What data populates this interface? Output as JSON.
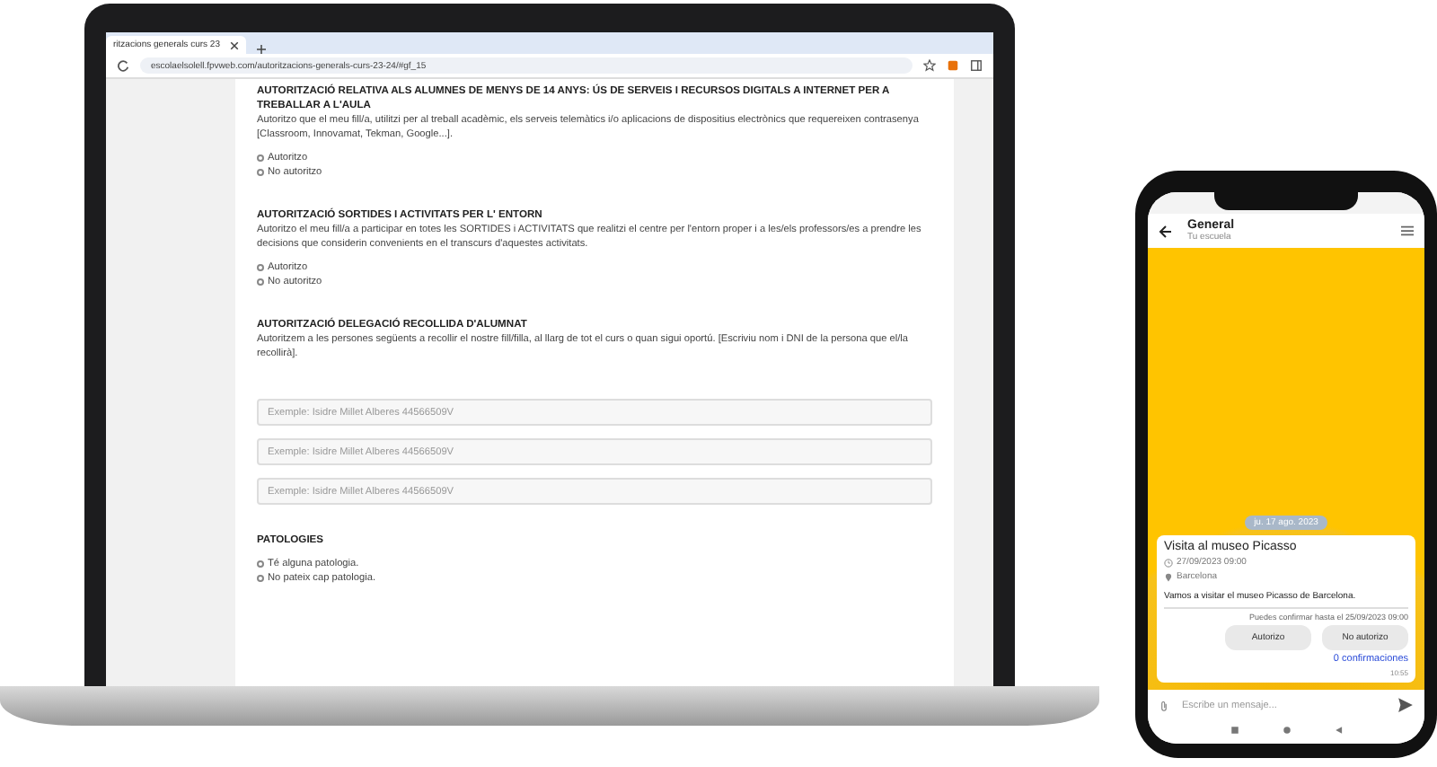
{
  "browser": {
    "tab_title": "ritzacions generals curs 23",
    "url": "escolaelsolell.fpvweb.com/autoritzacions-generals-curs-23-24/#gf_15"
  },
  "form": {
    "sections": [
      {
        "kind": "radio",
        "title": "AUTORITZACIÓ RELATIVA ALS ALUMNES DE MENYS DE 14 ANYS: ÚS DE SERVEIS I RECURSOS DIGITALS A INTERNET PER A TREBALLAR A L'AULA",
        "description": "Autoritzo que el meu fill/a, utilitzi per al treball acadèmic, els serveis telemàtics i/o aplicacions de dispositius electrònics que requereixen contrasenya [Classroom, Innovamat, Tekman, Google...].",
        "options": [
          {
            "label": "Autoritzo",
            "selected": false
          },
          {
            "label": "No autoritzo",
            "selected": false
          }
        ]
      },
      {
        "kind": "radio",
        "title": "AUTORITZACIÓ SORTIDES I ACTIVITATS PER L' ENTORN",
        "description": "Autoritzo el meu fill/a a participar en totes les SORTIDES i ACTIVITATS que realitzi el centre per l'entorn proper i a les/els professors/es a prendre les decisions que considerin convenients en el transcurs d'aquestes activitats.",
        "options": [
          {
            "label": "Autoritzo",
            "selected": false
          },
          {
            "label": "No autoritzo",
            "selected": false
          }
        ]
      },
      {
        "kind": "inputs",
        "title": "AUTORITZACIÓ DELEGACIÓ RECOLLIDA D'ALUMNAT",
        "description": "Autoritzem a les persones següents a recollir el nostre fill/filla, al llarg de tot el curs o quan sigui oportú. [Escriviu nom i DNI de la persona que el/la recollirà].",
        "fields": [
          {
            "placeholder": "Exemple: Isidre Millet Alberes 44566509V"
          },
          {
            "placeholder": "Exemple: Isidre Millet Alberes 44566509V"
          },
          {
            "placeholder": "Exemple: Isidre Millet Alberes 44566509V"
          }
        ]
      },
      {
        "kind": "radio",
        "title": "PATOLOGIES",
        "options": [
          {
            "label": "Té alguna patologia.",
            "selected": false
          },
          {
            "label": "No pateix cap patologia.",
            "selected": false
          }
        ]
      }
    ]
  },
  "phone": {
    "header": {
      "title": "General",
      "subtitle": "Tu escuela"
    },
    "date_chip": "ju. 17 ago. 2023",
    "message": {
      "title": "Visita al museo Picasso",
      "datetime": "27/09/2023 09:00",
      "location": "Barcelona",
      "body": "Vamos a visitar el museo Picasso de Barcelona.",
      "deadline": "Puedes confirmar hasta el 25/09/2023 09:00",
      "buttons": [
        "Autorizo",
        "No autorizo"
      ],
      "confirmations": "0 confirmaciones",
      "time": "10:55"
    },
    "composer": {
      "placeholder": "Escribe un mensaje..."
    }
  }
}
